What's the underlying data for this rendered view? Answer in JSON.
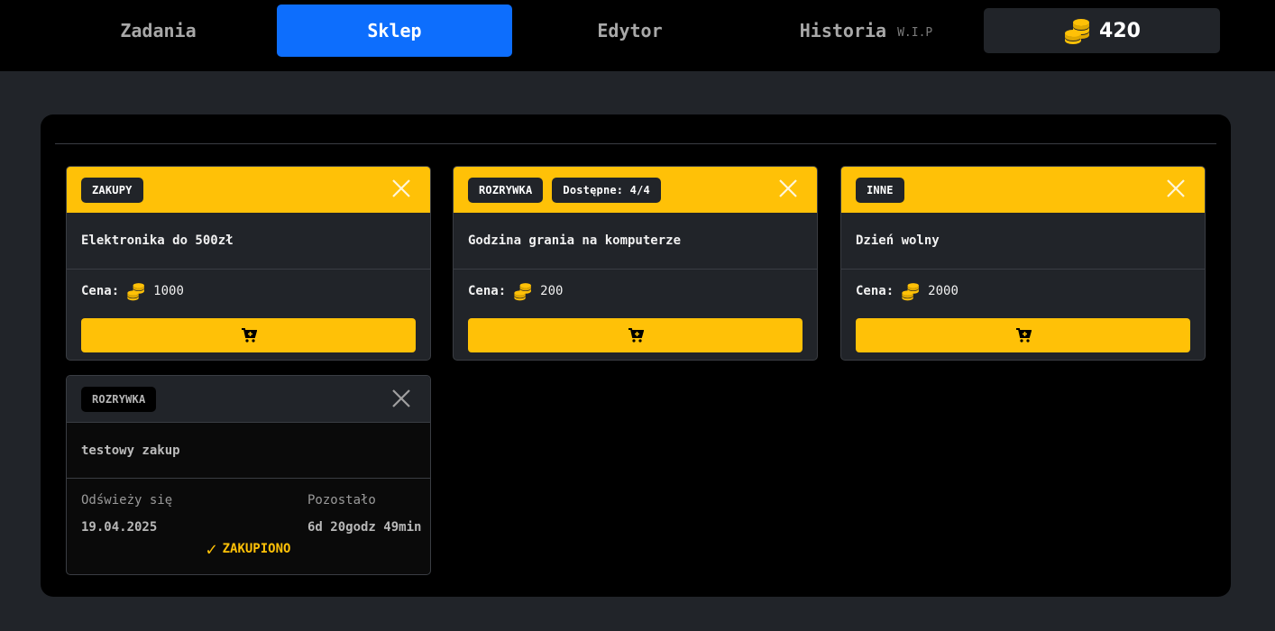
{
  "nav": {
    "tabs": [
      {
        "label": "Zadania",
        "active": false
      },
      {
        "label": "Sklep",
        "active": true
      },
      {
        "label": "Edytor",
        "active": false
      },
      {
        "label": "Historia",
        "suffix": "W.I.P",
        "active": false
      }
    ],
    "coins": "420"
  },
  "colors": {
    "accent": "#ffc107",
    "active_tab": "#0d6efd",
    "panel": "#000000",
    "background": "#212429"
  },
  "shop": {
    "items": [
      {
        "category": "ZAKUPY",
        "title": "Elektronika do 500zł",
        "price_label": "Cena:",
        "price": "1000"
      },
      {
        "category": "ROZRYWKA",
        "availability": "Dostępne: 4/4",
        "title": "Godzina grania na komputerze",
        "price_label": "Cena:",
        "price": "200"
      },
      {
        "category": "INNE",
        "title": "Dzień wolny",
        "price_label": "Cena:",
        "price": "2000"
      }
    ],
    "purchased": {
      "category": "ROZRYWKA",
      "title": "testowy zakup",
      "refresh_label": "Odświeży się",
      "refresh_date": "19.04.2025",
      "remaining_label": "Pozostało",
      "remaining": "6d 20godz 49min",
      "status": "ZAKUPIONO",
      "status_icon": "✓"
    }
  }
}
